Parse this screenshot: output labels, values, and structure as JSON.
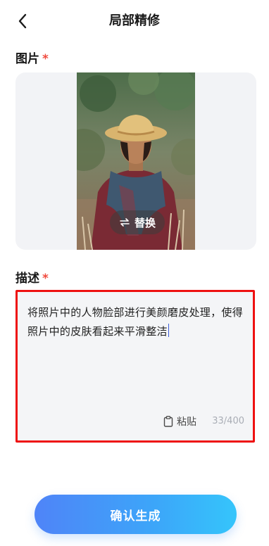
{
  "header": {
    "title": "局部精修"
  },
  "image_section": {
    "label": "图片",
    "required_mark": "*",
    "replace_label": "替换"
  },
  "description_section": {
    "label": "描述",
    "required_mark": "*",
    "text": "将照片中的人物脸部进行美颜磨皮处理，使得照片中的皮肤看起来平滑整洁",
    "paste_label": "粘贴",
    "char_count": "33/400"
  },
  "confirm": {
    "label": "确认生成"
  },
  "colors": {
    "required": "#f04a3e",
    "highlight_border": "#ee1111",
    "button_gradient_start": "#4f84f8",
    "button_gradient_end": "#35c5fb"
  },
  "icons": {
    "back": "chevron-left-icon",
    "replace": "swap-arrows-icon",
    "paste": "clipboard-icon"
  }
}
